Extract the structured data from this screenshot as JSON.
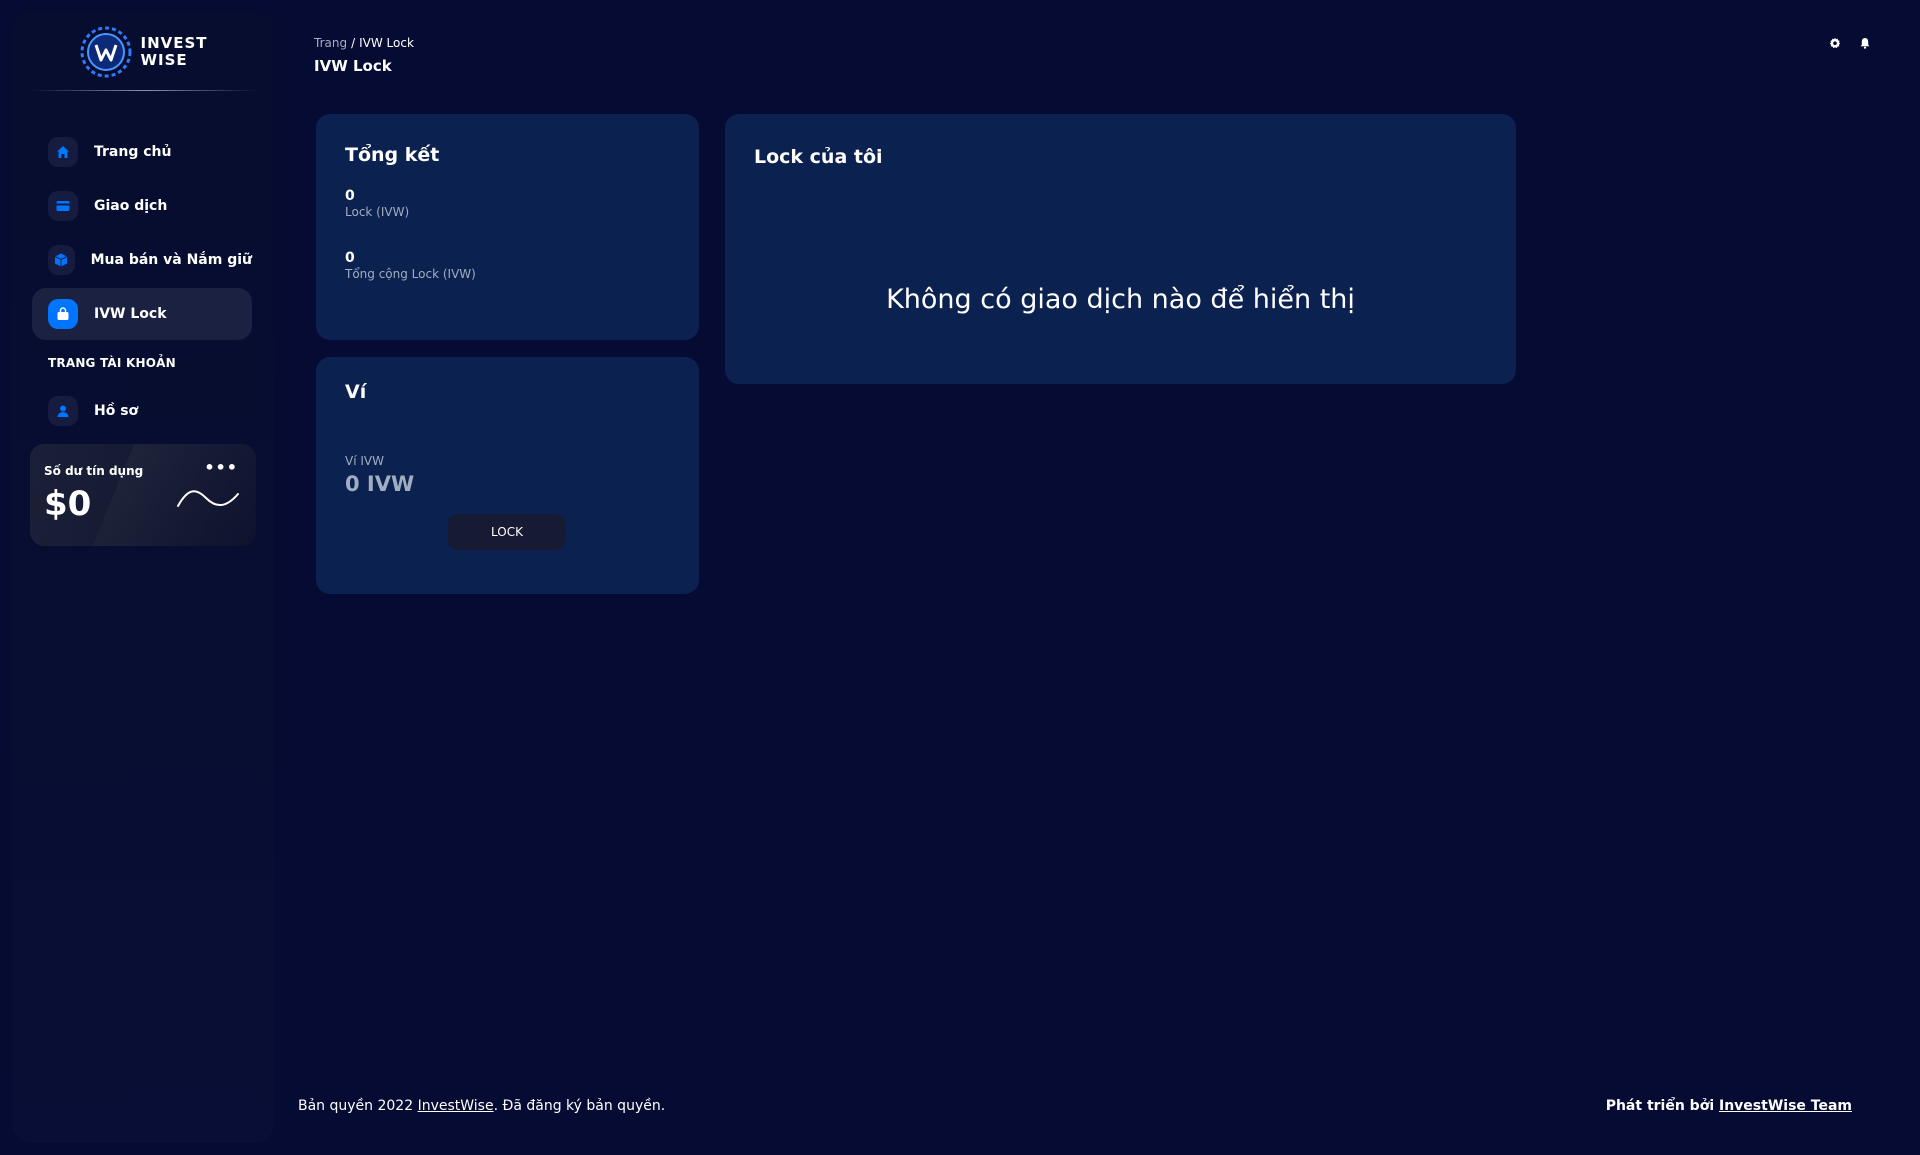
{
  "brand": {
    "line1": "INVEST",
    "line2": "WISE"
  },
  "sidebar": {
    "items": [
      {
        "label": "Trang chủ",
        "icon": "home-icon"
      },
      {
        "label": "Giao dịch",
        "icon": "credit-card-icon"
      },
      {
        "label": "Mua bán và Nắm giữ",
        "icon": "cube-icon"
      },
      {
        "label": "IVW Lock",
        "icon": "lock-bag-icon",
        "active": true
      }
    ],
    "section_title": "TRANG TÀI KHOẢN",
    "account_items": [
      {
        "label": "Hồ sơ",
        "icon": "person-icon"
      }
    ],
    "credit": {
      "title": "Số dư tín dụng",
      "amount": "$0",
      "more": "•••"
    }
  },
  "header": {
    "breadcrumb_root": "Trang",
    "breadcrumb_sep": "/",
    "breadcrumb_current": "IVW Lock",
    "title": "IVW Lock"
  },
  "summary": {
    "title": "Tổng kết",
    "lock_value": "0",
    "lock_label": "Lock (IVW)",
    "total_value": "0",
    "total_label": "Tổng cộng Lock (IVW)"
  },
  "wallet": {
    "title": "Ví",
    "label": "Ví IVW",
    "value": "0 IVW",
    "button": "LOCK"
  },
  "my_lock": {
    "title": "Lock của tôi",
    "empty": "Không có giao dịch nào để hiển thị"
  },
  "footer": {
    "left_prefix": "Bản quyền 2022 ",
    "left_link": "InvestWise",
    "left_suffix": ". Đã đăng ký bản quyền.",
    "right_prefix": "Phát triển bởi ",
    "right_link": "InvestWise Team"
  },
  "colors": {
    "background": "#050b33",
    "card": "#0b2150",
    "accent": "#0075ff",
    "muted_text": "#a0aec0"
  }
}
